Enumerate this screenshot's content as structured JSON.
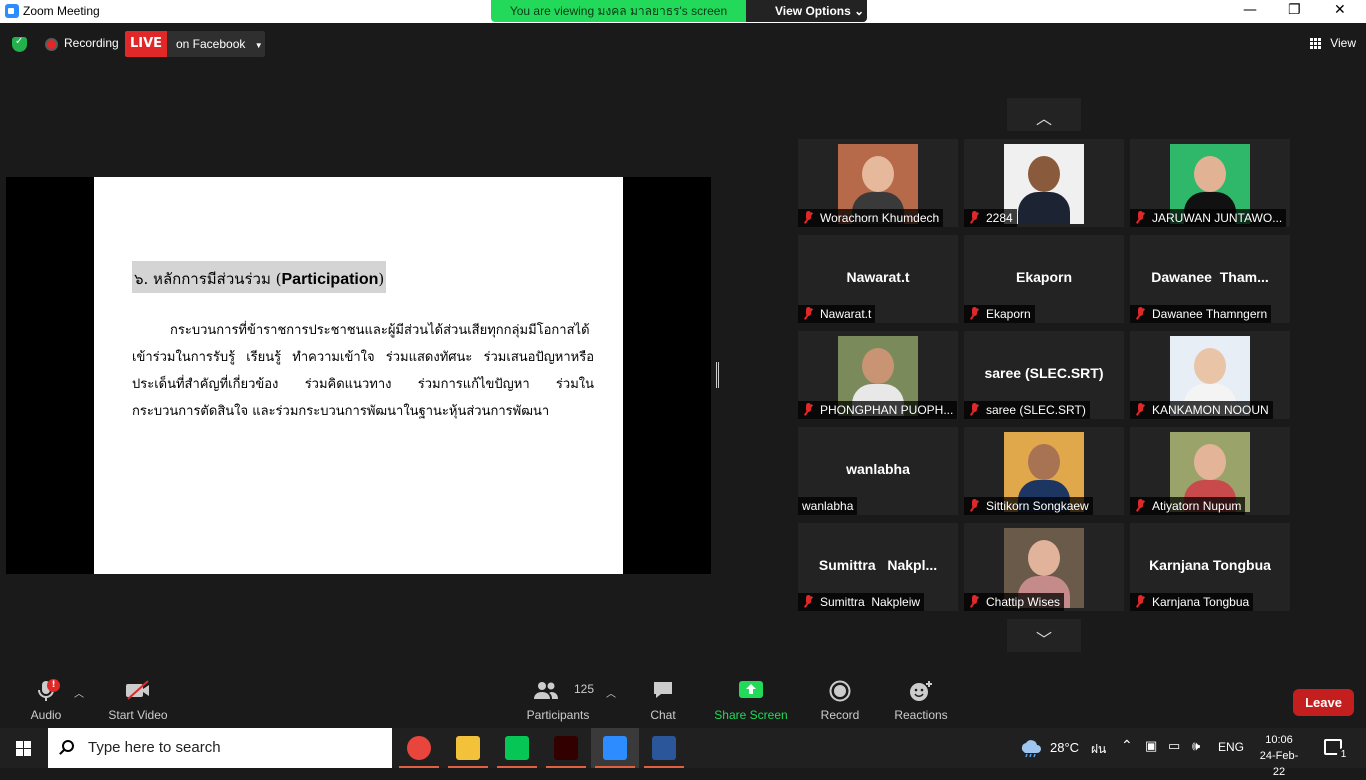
{
  "window": {
    "title": "Zoom Meeting",
    "viewing_banner": "You are viewing มงคล  มาลยาธร's screen",
    "view_options": "View Options",
    "minimize": "—",
    "maximize": "❐",
    "close": "✕"
  },
  "topbar": {
    "recording_label": "Recording",
    "live_label": "LIVE",
    "live_destination": "on Facebook",
    "view_label": "View"
  },
  "slide": {
    "heading_thai": "๖. หลักการมีส่วนร่วม (",
    "heading_en": "Participation",
    "heading_close": ")",
    "body": "กระบวนการที่ข้าราชการประชาชนและผู้มีส่วนได้ส่วนเสียทุกกลุ่มมีโอกาสได้เข้าร่วมในการรับรู้ เรียนรู้ ทำความเข้าใจ ร่วมแสดงทัศนะ ร่วมเสนอปัญหาหรือ ประเด็นที่สำคัญที่เกี่ยวข้อง ร่วมคิดแนวทาง ร่วมการแก้ไขปัญหา ร่วมในกระบวนการตัดสินใจ และร่วมกระบวนการพัฒนาในฐานะหุ้นส่วนการพัฒนา"
  },
  "gallery": {
    "up_arrow": "︿",
    "down_arrow": "﹀",
    "tiles": [
      {
        "label": "Worachorn Khumdech",
        "big": "",
        "muted": true,
        "photo": true,
        "bg": "#b76a4a",
        "skin": "#e6b99c",
        "shirt": "#3a3a3a"
      },
      {
        "label": "2284",
        "big": "",
        "muted": true,
        "photo": true,
        "bg": "#f0f0f0",
        "skin": "#8a5a3c",
        "shirt": "#1c2433"
      },
      {
        "label": "JARUWAN JUNTAWO...",
        "big": "",
        "muted": true,
        "photo": true,
        "bg": "#2fb86a",
        "skin": "#e2b295",
        "shirt": "#111111"
      },
      {
        "label": "Nawarat.t",
        "big": "Nawarat.t",
        "muted": true,
        "photo": false
      },
      {
        "label": "Ekaporn",
        "big": "Ekaporn",
        "muted": true,
        "photo": false
      },
      {
        "label": "Dawanee Thamngern",
        "big": "Dawanee  Tham...",
        "muted": true,
        "photo": false
      },
      {
        "label": "PHONGPHAN PUOPH...",
        "big": "",
        "muted": true,
        "photo": true,
        "bg": "#7b8a5a",
        "skin": "#c89474",
        "shirt": "#e8e8e8"
      },
      {
        "label": "saree (SLEC.SRT)",
        "big": "saree (SLEC.SRT)",
        "muted": true,
        "photo": false
      },
      {
        "label": "KANKAMON NOOUN",
        "big": "",
        "muted": true,
        "photo": true,
        "bg": "#e8eef5",
        "skin": "#e9c4a6",
        "shirt": "#f4f4f4"
      },
      {
        "label": "wanlabha",
        "big": "wanlabha",
        "muted": false,
        "photo": false
      },
      {
        "label": "Sittikorn Songkaew",
        "big": "",
        "muted": true,
        "photo": true,
        "bg": "#e0a84a",
        "skin": "#a77353",
        "shirt": "#1c3561"
      },
      {
        "label": "Atiyatorn Nupum",
        "big": "",
        "muted": true,
        "photo": true,
        "bg": "#9aa46a",
        "skin": "#e3b497",
        "shirt": "#c84a4a"
      },
      {
        "label": "Sumittra  Nakpleiw",
        "big": "Sumittra   Nakpl...",
        "muted": true,
        "photo": false
      },
      {
        "label": "Chattip Wises",
        "big": "",
        "muted": true,
        "photo": true,
        "bg": "#6a5a4a",
        "skin": "#e0b39a",
        "shirt": "#c58a8a"
      },
      {
        "label": "Karnjana Tongbua",
        "big": "Karnjana Tongbua",
        "muted": true,
        "photo": false
      }
    ]
  },
  "toolbar": {
    "audio": "Audio",
    "audio_badge": "!",
    "video": "Start Video",
    "participants": "Participants",
    "participants_count": "125",
    "chat": "Chat",
    "share": "Share Screen",
    "record": "Record",
    "reactions": "Reactions",
    "leave": "Leave"
  },
  "taskbar": {
    "search_placeholder": "Type here to search",
    "weather": "28°C",
    "weather_text": "ฝน",
    "lang": "ENG",
    "time": "10:06",
    "date": "24-Feb-22",
    "notif_count": "1",
    "apps": [
      {
        "name": "chrome",
        "color": "#e8453c"
      },
      {
        "name": "file-explorer",
        "color": "#f3c13a"
      },
      {
        "name": "line",
        "color": "#06c755"
      },
      {
        "name": "illustrator",
        "color": "#330000"
      },
      {
        "name": "zoom",
        "color": "#2d8cff"
      },
      {
        "name": "word",
        "color": "#2b579a"
      }
    ]
  }
}
